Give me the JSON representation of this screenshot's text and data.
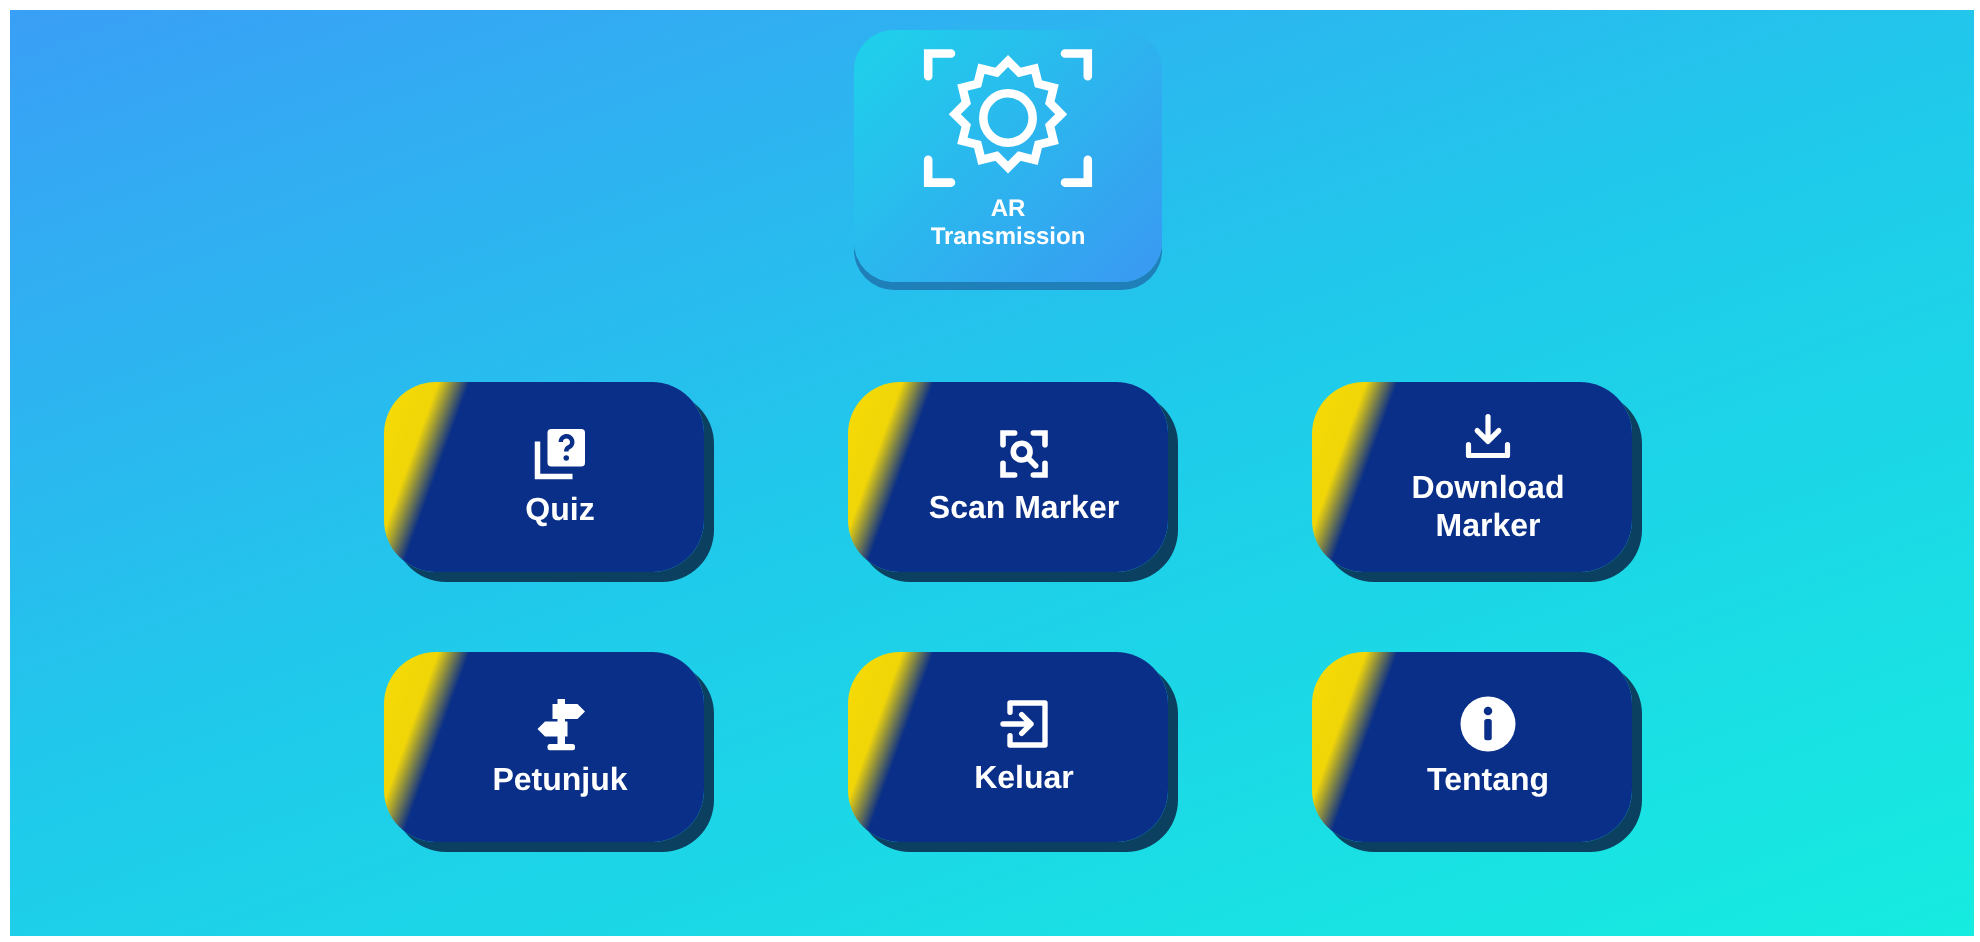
{
  "logo": {
    "title": "AR",
    "subtitle": "Transmission"
  },
  "menu": [
    {
      "kind": "quiz",
      "label": "Quiz"
    },
    {
      "kind": "scan",
      "label": "Scan Marker"
    },
    {
      "kind": "download",
      "label": "Download Marker"
    },
    {
      "kind": "signpost",
      "label": "Petunjuk"
    },
    {
      "kind": "exit",
      "label": "Keluar"
    },
    {
      "kind": "info",
      "label": "Tentang"
    }
  ]
}
